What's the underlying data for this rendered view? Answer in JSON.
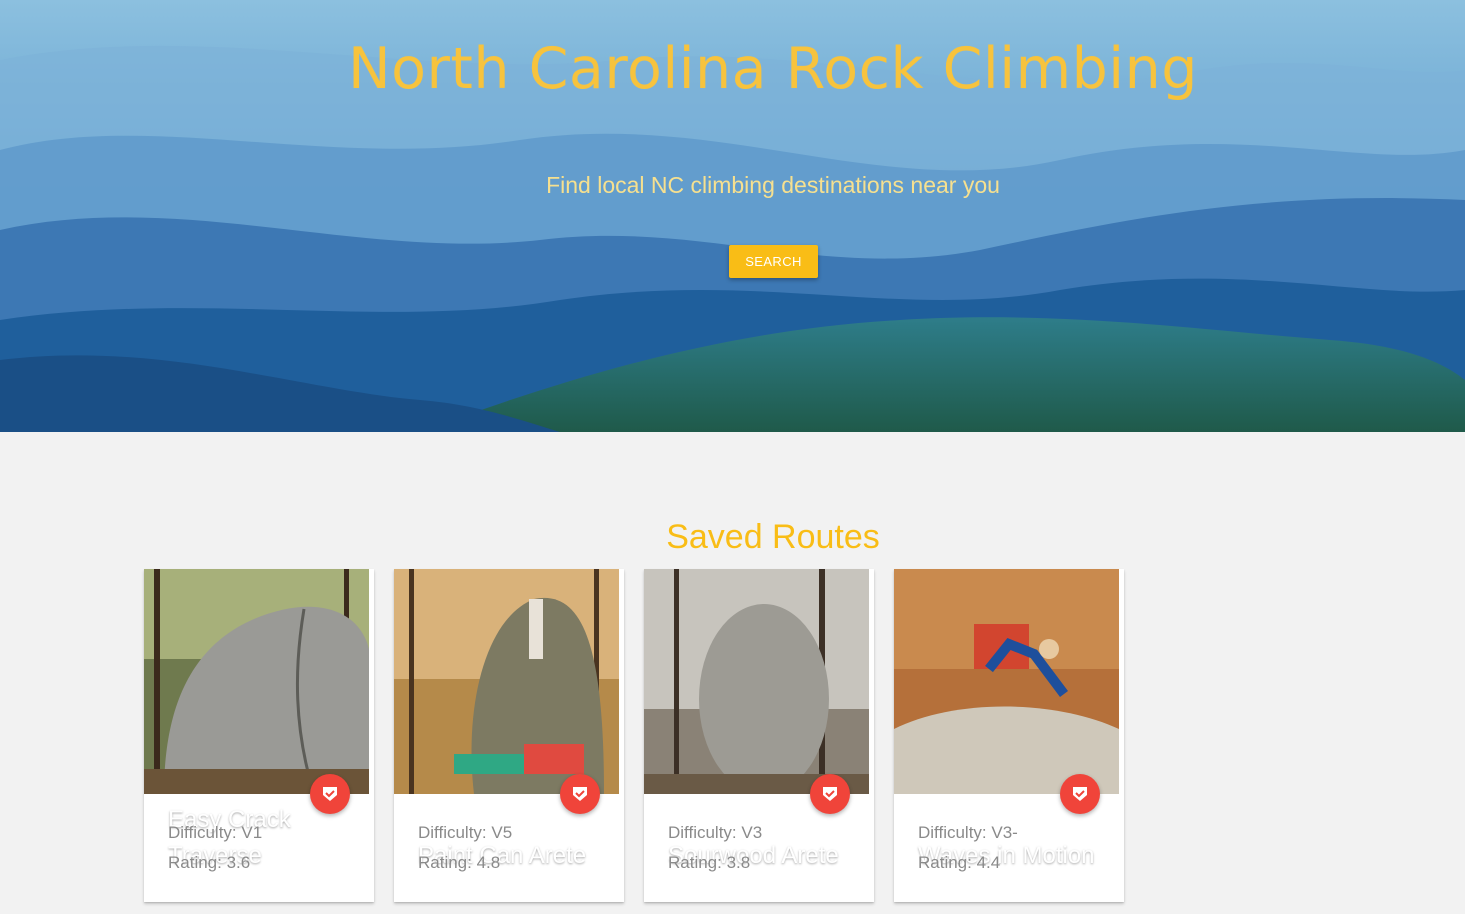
{
  "hero": {
    "title": "North Carolina Rock Climbing",
    "subtitle": "Find local NC climbing destinations near you",
    "search_label": "SEARCH"
  },
  "saved": {
    "title": "Saved Routes",
    "cards": [
      {
        "name": "Easy Crack Traverse",
        "difficulty": "Difficulty: V1",
        "rating": "Rating: 3.6"
      },
      {
        "name": "Paint Can Arete",
        "difficulty": "Difficulty: V5",
        "rating": "Rating: 4.8"
      },
      {
        "name": "Sourwood Arete",
        "difficulty": "Difficulty: V3",
        "rating": "Rating: 3.8"
      },
      {
        "name": "Waves in Motion",
        "difficulty": "Difficulty: V3-",
        "rating": "Rating: 4.4"
      }
    ]
  },
  "icons": {
    "save": "bookmark-check-icon"
  },
  "colors": {
    "accent": "#f9bd16",
    "title_yellow": "#f7c33d",
    "fab_red": "#f0443a",
    "background": "#f2f2f2"
  }
}
